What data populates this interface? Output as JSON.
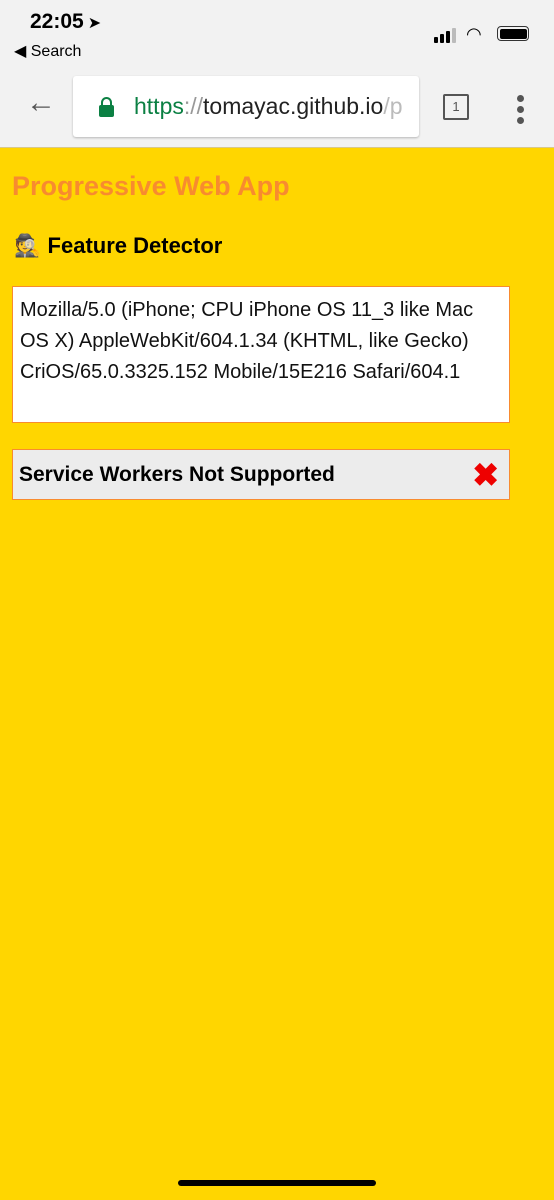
{
  "status_bar": {
    "time": "22:05",
    "location_icon": "➤",
    "back_label": "◀ Search"
  },
  "browser": {
    "url_scheme": "https",
    "url_sep": "://",
    "url_host": "tomayac.github.io",
    "url_rest": "/p",
    "tab_count": "1"
  },
  "page": {
    "title": "Progressive Web App",
    "subtitle_emoji": "🕵",
    "subtitle": "Feature Detector",
    "user_agent": "Mozilla/5.0 (iPhone; CPU iPhone OS 11_3 like Mac OS X) AppleWebKit/604.1.34 (KHTML, like Gecko) CriOS/65.0.3325.152 Mobile/15E216 Safari/604.1",
    "features": [
      {
        "label": "Service Workers Not Supported",
        "status_icon": "✖"
      }
    ]
  },
  "colors": {
    "background": "#FFD600",
    "title": "#F88B2F",
    "secure": "#0b8043",
    "error": "#e00000"
  }
}
